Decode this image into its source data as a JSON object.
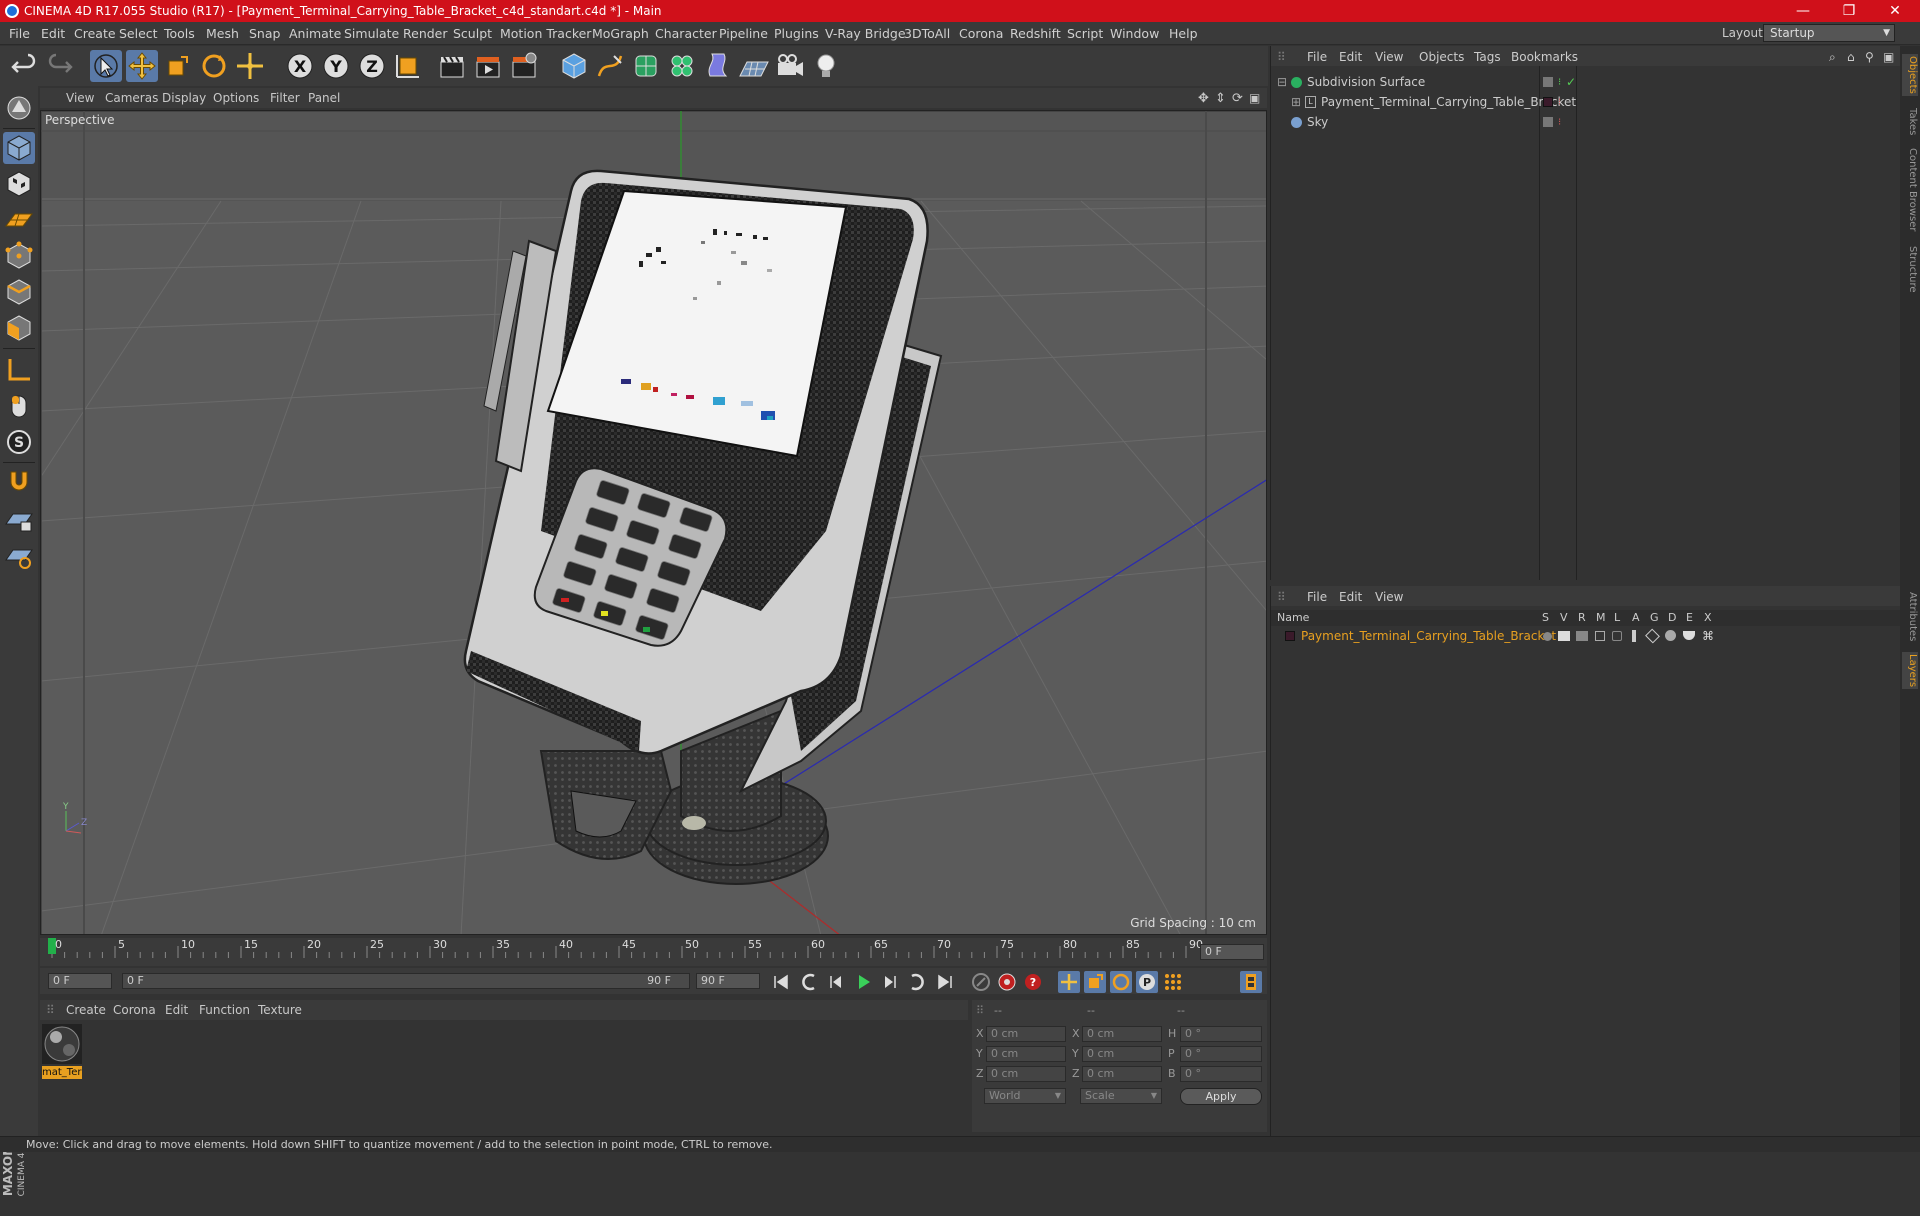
{
  "window": {
    "title": "CINEMA 4D R17.055 Studio (R17) - [Payment_Terminal_Carrying_Table_Bracket_c4d_standart.c4d *] - Main",
    "minimize": "—",
    "restore": "❐",
    "close": "✕"
  },
  "menu": [
    "File",
    "Edit",
    "Create",
    "Select",
    "Tools",
    "Mesh",
    "Snap",
    "Animate",
    "Simulate",
    "Render",
    "Sculpt",
    "Motion Tracker",
    "MoGraph",
    "Character",
    "Pipeline",
    "Plugins",
    "V-Ray Bridge",
    "3DToAll",
    "Corona",
    "Redshift",
    "Script",
    "Window",
    "Help"
  ],
  "layout": {
    "label": "Layout:",
    "value": "Startup"
  },
  "viewport": {
    "menu": [
      "View",
      "Cameras",
      "Display",
      "Options",
      "Filter",
      "Panel"
    ],
    "label": "Perspective",
    "grid_spacing": "Grid Spacing : 10 cm"
  },
  "timeline": {
    "ticks": [
      "0",
      "5",
      "10",
      "15",
      "20",
      "25",
      "30",
      "35",
      "40",
      "45",
      "50",
      "55",
      "60",
      "65",
      "70",
      "75",
      "80",
      "85",
      "90"
    ],
    "current_frame": "0 F",
    "start": "0 F",
    "range_start": "0 F",
    "range_end": "90 F",
    "end": "90 F"
  },
  "material_manager": {
    "menu": [
      "Create",
      "Corona",
      "Edit",
      "Function",
      "Texture"
    ],
    "material_name": "mat_Ter"
  },
  "coordinates": {
    "headers": [
      "--",
      "--",
      "--"
    ],
    "rows": [
      {
        "a": "X",
        "av": "0 cm",
        "b": "X",
        "bv": "0 cm",
        "c": "H",
        "cv": "0 °"
      },
      {
        "a": "Y",
        "av": "0 cm",
        "b": "Y",
        "bv": "0 cm",
        "c": "P",
        "cv": "0 °"
      },
      {
        "a": "Z",
        "av": "0 cm",
        "b": "Z",
        "bv": "0 cm",
        "c": "B",
        "cv": "0 °"
      }
    ],
    "mode1": "World",
    "mode2": "Scale",
    "apply": "Apply"
  },
  "object_manager": {
    "menu": [
      "File",
      "Edit",
      "View",
      "Objects",
      "Tags",
      "Bookmarks"
    ],
    "objects": [
      {
        "name": "Subdivision Surface"
      },
      {
        "name": "Payment_Terminal_Carrying_Table_Bracket"
      },
      {
        "name": "Sky"
      }
    ]
  },
  "layer_manager": {
    "menu": [
      "File",
      "Edit",
      "View"
    ],
    "columns": [
      "Name",
      "S",
      "V",
      "R",
      "M",
      "L",
      "A",
      "G",
      "D",
      "E",
      "X"
    ],
    "layer": "Payment_Terminal_Carrying_Table_Bracket"
  },
  "right_tabs": [
    "Objects",
    "Takes",
    "Content Browser",
    "Structure",
    "Attributes",
    "Layers"
  ],
  "side_logo": [
    "MAXON",
    "CINEMA 4D"
  ],
  "status": "Move: Click and drag to move elements. Hold down SHIFT to quantize movement / add to the selection in point mode, CTRL to remove.",
  "colors": {
    "titlebar": "#d0101a",
    "accent": "#5a7aa8",
    "layer_text": "#e8a020"
  }
}
